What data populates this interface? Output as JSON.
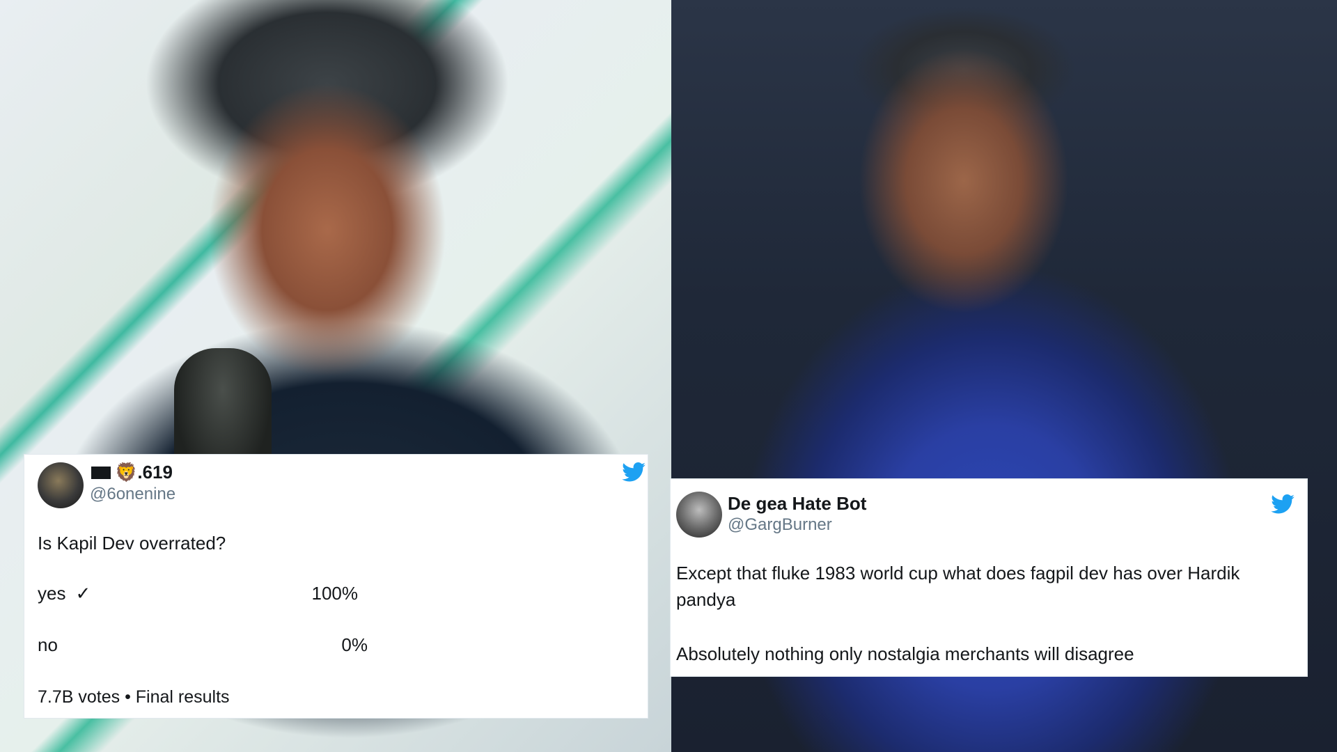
{
  "tweet1": {
    "name_text": "🦁.619",
    "handle": "@6onenine",
    "question": "Is Kapil Dev overrated?",
    "poll": [
      {
        "label": "yes",
        "mark": "✓",
        "percent": "100%"
      },
      {
        "label": "no",
        "mark": "",
        "percent": "0%"
      }
    ],
    "meta": "7.7B votes • Final results"
  },
  "tweet2": {
    "name": "De gea Hate Bot",
    "handle": "@GargBurner",
    "text1": "Except that fluke 1983 world cup what does fagpil dev has over Hardik pandya",
    "text2": "Absolutely nothing only nostalgia merchants will disagree"
  },
  "icons": {
    "brand": "twitter-bird-icon",
    "brand_color": "#1da1f2"
  }
}
